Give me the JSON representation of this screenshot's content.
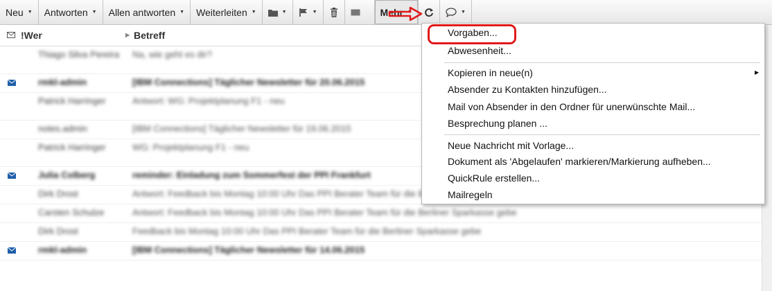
{
  "toolbar": {
    "new": "Neu",
    "reply": "Antworten",
    "reply_all": "Allen antworten",
    "forward": "Weiterleiten",
    "more": "Mehr"
  },
  "header": {
    "who": "!Wer",
    "subject": "Betreff"
  },
  "messages": [
    {
      "sender": "Thiago Silva Pereira",
      "subject": "Na, wie geht es dir?",
      "unread": false
    },
    {
      "sender": "rmkl-admin",
      "subject": "[IBM Connections] Täglicher Newsletter für 20.06.2015",
      "unread": true
    },
    {
      "sender": "Patrick Harringer",
      "subject": "Antwort: WG: Projektplanung F1 - neu",
      "unread": false
    },
    {
      "sender": "notes.admin",
      "subject": "[IBM Connections] Täglicher Newsletter für 19.06.2015",
      "unread": false
    },
    {
      "sender": "Patrick Harringer",
      "subject": "WG: Projektplanung F1 - neu",
      "unread": false
    },
    {
      "sender": "Julia Colberg",
      "subject": "reminder: Einladung zum Sommerfest der PPI Frankfurt",
      "unread": true
    },
    {
      "sender": "Dirk Drost",
      "subject": "Antwort: Feedback bis Montag 10:00 Uhr Das PPI Berater Team für die Berliner Sparkasse gebe",
      "unread": false
    },
    {
      "sender": "Carsten Schulze",
      "subject": "Antwort: Feedback bis Montag 10:00 Uhr Das PPI Berater Team für die Berliner Sparkasse gebe",
      "unread": false
    },
    {
      "sender": "Dirk Drost",
      "subject": "Feedback bis Montag 10:00 Uhr Das PPI Berater Team für die Berliner Sparkasse gebe",
      "unread": false
    },
    {
      "sender": "rmkl-admin",
      "subject": "[IBM Connections] Täglicher Newsletter für 14.06.2015",
      "unread": true
    }
  ],
  "more_menu": {
    "defaults": "Vorgaben...",
    "out_of_office": "Abwesenheit...",
    "copy_into_new": "Kopieren in neue(n)",
    "add_sender_contacts": "Absender zu Kontakten hinzufügen...",
    "move_sender_junk": "Mail von Absender in den Ordner für unerwünschte Mail...",
    "schedule_meeting": "Besprechung planen ...",
    "new_from_template": "Neue Nachricht mit Vorlage...",
    "mark_expired": "Dokument als 'Abgelaufen' markieren/Markierung aufheben...",
    "create_quickrule": "QuickRule erstellen...",
    "mail_rules": "Mailregeln"
  },
  "colors": {
    "annotation_red": "#e11a1a",
    "unread_icon_blue": "#1f5fa8"
  }
}
